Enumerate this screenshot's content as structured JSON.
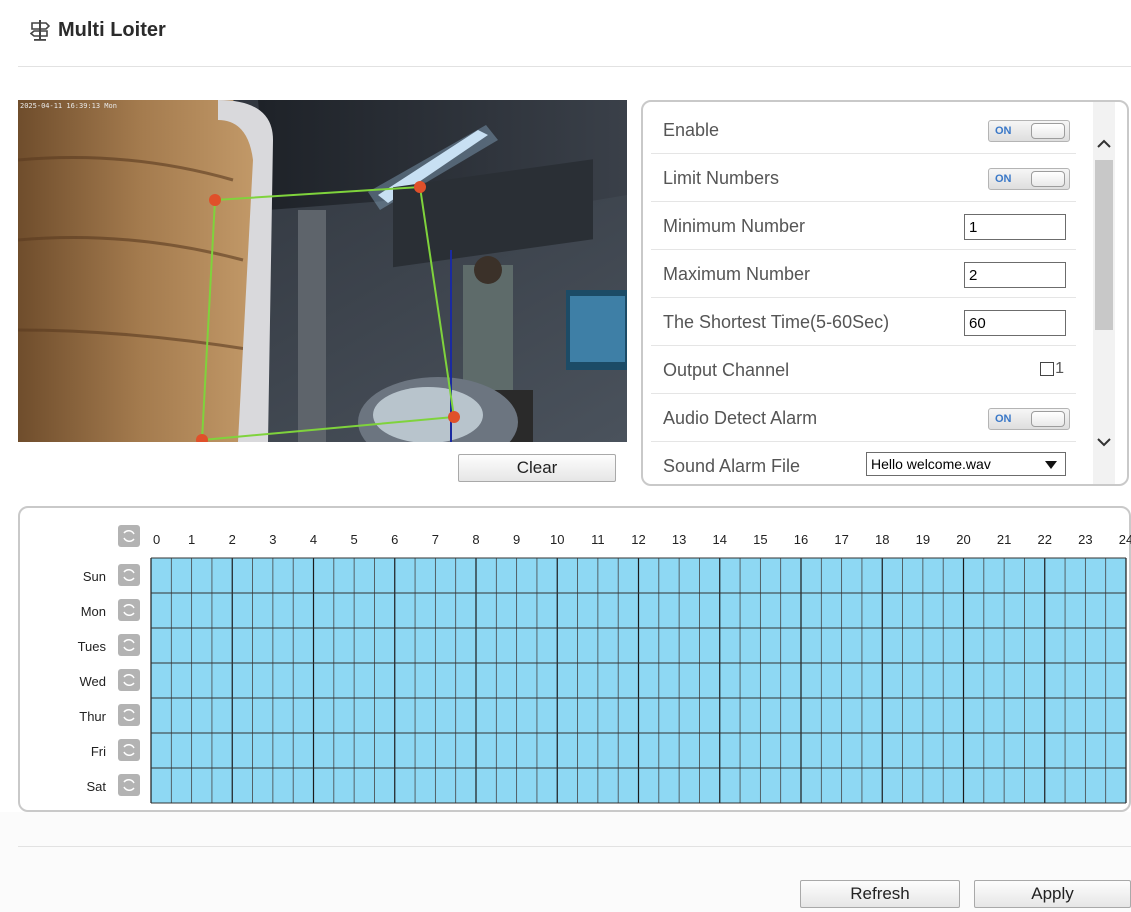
{
  "page": {
    "title": "Multi Loiter",
    "icon": "signpost-icon"
  },
  "video": {
    "timestamp": "2025-04-11 16:39:13 Mon",
    "region_vertices": 4
  },
  "clear_button": "Clear",
  "settings": {
    "enable": {
      "label": "Enable",
      "toggle": "ON"
    },
    "limit_numbers": {
      "label": "Limit Numbers",
      "toggle": "ON"
    },
    "minimum_number": {
      "label": "Minimum Number",
      "value": "1"
    },
    "maximum_number": {
      "label": "Maximum Number",
      "value": "2"
    },
    "shortest_time": {
      "label": "The Shortest Time(5-60Sec)",
      "value": "60"
    },
    "output_channel": {
      "label": "Output Channel",
      "option": "1",
      "checked": false
    },
    "audio_detect_alarm": {
      "label": "Audio Detect Alarm",
      "toggle": "ON"
    },
    "sound_alarm_file": {
      "label": "Sound Alarm File",
      "selected": "Hello welcome.wav"
    }
  },
  "schedule": {
    "days": [
      "Sun",
      "Mon",
      "Tues",
      "Wed",
      "Thur",
      "Fri",
      "Sat"
    ],
    "hours": [
      "0",
      "1",
      "2",
      "3",
      "4",
      "5",
      "6",
      "7",
      "8",
      "9",
      "10",
      "11",
      "12",
      "13",
      "14",
      "15",
      "16",
      "17",
      "18",
      "19",
      "20",
      "21",
      "22",
      "23",
      "24"
    ],
    "cells_per_hour": 2,
    "all_selected": true,
    "fill_color": "#8ed8f3"
  },
  "footer": {
    "refresh": "Refresh",
    "apply": "Apply"
  }
}
